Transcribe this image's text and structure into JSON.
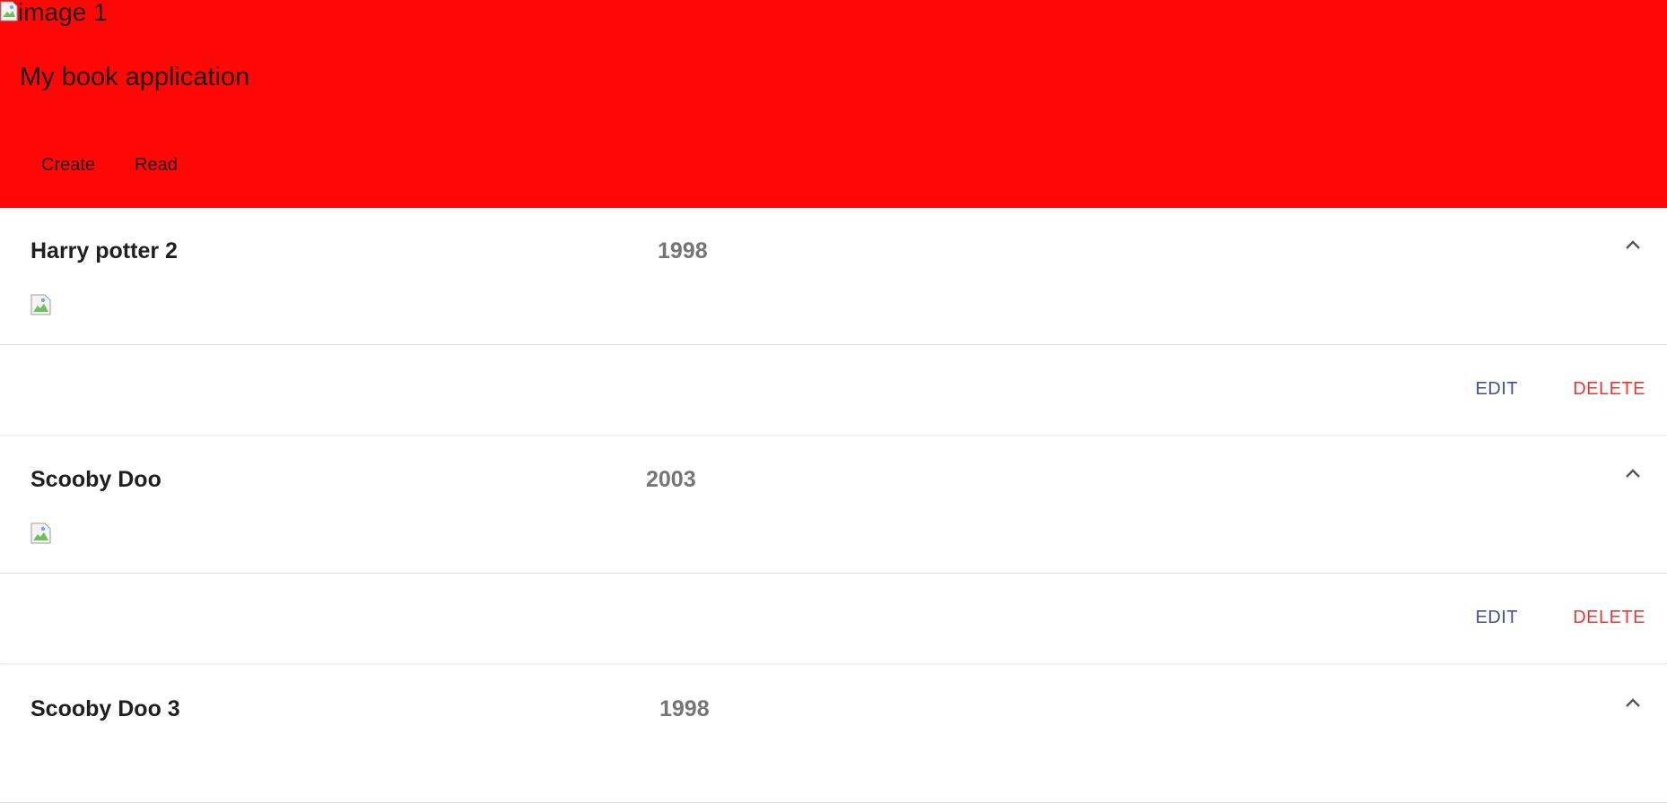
{
  "header": {
    "image_alt": "image 1",
    "app_title": "My book application",
    "nav": [
      {
        "label": "Create"
      },
      {
        "label": "Read"
      }
    ],
    "background_color": "#ff0707"
  },
  "books": [
    {
      "title": "Harry potter 2",
      "year": "1998",
      "edit_label": "EDIT",
      "delete_label": "DELETE"
    },
    {
      "title": "Scooby Doo",
      "year": "2003",
      "edit_label": "EDIT",
      "delete_label": "DELETE"
    },
    {
      "title": "Scooby Doo 3",
      "year": "1998"
    }
  ],
  "colors": {
    "edit": "#3f4fa0",
    "delete": "#e53935",
    "year": "#757575"
  },
  "icons": {
    "collapse": "chevron-up-icon",
    "broken_image": "broken-image-icon"
  }
}
